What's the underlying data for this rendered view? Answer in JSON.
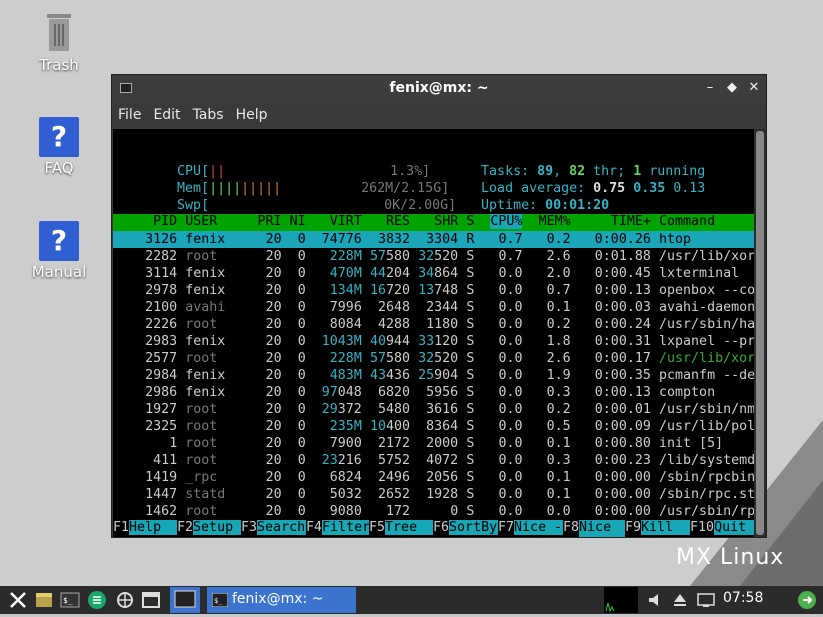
{
  "desktop": {
    "icons": [
      {
        "label": "Trash",
        "icon": "trash-icon"
      },
      {
        "label": "FAQ",
        "icon": "question-icon"
      },
      {
        "label": "Manual",
        "icon": "question-icon"
      }
    ],
    "logo": "MX Linux",
    "colors": {
      "accent": "#3b73cf",
      "background": "#cfcfcf"
    }
  },
  "window": {
    "title": "fenix@mx: ~",
    "menu": [
      "File",
      "Edit",
      "Tabs",
      "Help"
    ]
  },
  "htop": {
    "meters": {
      "cpu_label": "CPU[",
      "cpu_value": "1.3%]",
      "mem_label": "Mem[",
      "mem_value": "262M/2.15G]",
      "swp_label": "Swp[",
      "swp_value": "0K/2.00G]"
    },
    "tasks": {
      "label": "Tasks:",
      "count": "89",
      "thr": "82",
      "thr_label": "thr;",
      "running": "1",
      "running_label": "running"
    },
    "load": {
      "label": "Load average:",
      "v1": "0.75",
      "v2": "0.35",
      "v3": "0.13"
    },
    "uptime": {
      "label": "Uptime:",
      "value": "00:01:20"
    },
    "columns": [
      "PID",
      "USER",
      "PRI",
      "NI",
      "VIRT",
      "RES",
      "SHR",
      "S",
      "CPU%",
      "MEM%",
      "TIME+",
      "Command"
    ],
    "processes": [
      {
        "pid": "3126",
        "user": "fenix",
        "pri": "20",
        "ni": "0",
        "virt": "74776",
        "res": "3832",
        "shr": "3304",
        "s": "R",
        "cpu": "0.7",
        "mem": "0.2",
        "time": "0:00.26",
        "cmd": "htop"
      },
      {
        "pid": "2282",
        "user": "root",
        "pri": "20",
        "ni": "0",
        "virt": "228M",
        "res": "57580",
        "shr": "32520",
        "s": "S",
        "cpu": "0.7",
        "mem": "2.6",
        "time": "0:01.88",
        "cmd": "/usr/lib/xorg/Xor"
      },
      {
        "pid": "3114",
        "user": "fenix",
        "pri": "20",
        "ni": "0",
        "virt": "470M",
        "res": "44204",
        "shr": "34864",
        "s": "S",
        "cpu": "0.0",
        "mem": "2.0",
        "time": "0:00.45",
        "cmd": "lxterminal"
      },
      {
        "pid": "2978",
        "user": "fenix",
        "pri": "20",
        "ni": "0",
        "virt": "134M",
        "res": "16720",
        "shr": "13748",
        "s": "S",
        "cpu": "0.0",
        "mem": "0.7",
        "time": "0:00.13",
        "cmd": "openbox --config-"
      },
      {
        "pid": "2100",
        "user": "avahi",
        "pri": "20",
        "ni": "0",
        "virt": "7996",
        "res": "2648",
        "shr": "2344",
        "s": "S",
        "cpu": "0.0",
        "mem": "0.1",
        "time": "0:00.03",
        "cmd": "avahi-daemon: run"
      },
      {
        "pid": "2226",
        "user": "root",
        "pri": "20",
        "ni": "0",
        "virt": "8084",
        "res": "4288",
        "shr": "1180",
        "s": "S",
        "cpu": "0.0",
        "mem": "0.2",
        "time": "0:00.24",
        "cmd": "/usr/sbin/haveged"
      },
      {
        "pid": "2983",
        "user": "fenix",
        "pri": "20",
        "ni": "0",
        "virt": "1043M",
        "res": "40944",
        "shr": "33120",
        "s": "S",
        "cpu": "0.0",
        "mem": "1.8",
        "time": "0:00.31",
        "cmd": "lxpanel --profile"
      },
      {
        "pid": "2577",
        "user": "root",
        "pri": "20",
        "ni": "0",
        "virt": "228M",
        "res": "57580",
        "shr": "32520",
        "s": "S",
        "cpu": "0.0",
        "mem": "2.6",
        "time": "0:00.17",
        "cmd": "/usr/lib/xorg/Xor"
      },
      {
        "pid": "2984",
        "user": "fenix",
        "pri": "20",
        "ni": "0",
        "virt": "483M",
        "res": "43436",
        "shr": "25904",
        "s": "S",
        "cpu": "0.0",
        "mem": "1.9",
        "time": "0:00.35",
        "cmd": "pcmanfm --desktop"
      },
      {
        "pid": "2986",
        "user": "fenix",
        "pri": "20",
        "ni": "0",
        "virt": "97048",
        "res": "6820",
        "shr": "5956",
        "s": "S",
        "cpu": "0.0",
        "mem": "0.3",
        "time": "0:00.13",
        "cmd": "compton"
      },
      {
        "pid": "1927",
        "user": "root",
        "pri": "20",
        "ni": "0",
        "virt": "29372",
        "res": "5480",
        "shr": "3616",
        "s": "S",
        "cpu": "0.0",
        "mem": "0.2",
        "time": "0:00.01",
        "cmd": "/usr/sbin/nmbd -D"
      },
      {
        "pid": "2325",
        "user": "root",
        "pri": "20",
        "ni": "0",
        "virt": "235M",
        "res": "10400",
        "shr": "8364",
        "s": "S",
        "cpu": "0.0",
        "mem": "0.5",
        "time": "0:00.09",
        "cmd": "/usr/lib/policyki"
      },
      {
        "pid": "1",
        "user": "root",
        "pri": "20",
        "ni": "0",
        "virt": "7900",
        "res": "2172",
        "shr": "2000",
        "s": "S",
        "cpu": "0.0",
        "mem": "0.1",
        "time": "0:00.80",
        "cmd": "init [5]"
      },
      {
        "pid": "411",
        "user": "root",
        "pri": "20",
        "ni": "0",
        "virt": "23216",
        "res": "5752",
        "shr": "4072",
        "s": "S",
        "cpu": "0.0",
        "mem": "0.3",
        "time": "0:00.23",
        "cmd": "/lib/systemd/syst"
      },
      {
        "pid": "1419",
        "user": "_rpc",
        "pri": "20",
        "ni": "0",
        "virt": "6824",
        "res": "2496",
        "shr": "2056",
        "s": "S",
        "cpu": "0.0",
        "mem": "0.1",
        "time": "0:00.00",
        "cmd": "/sbin/rpcbind -w"
      },
      {
        "pid": "1447",
        "user": "statd",
        "pri": "20",
        "ni": "0",
        "virt": "5032",
        "res": "2652",
        "shr": "1928",
        "s": "S",
        "cpu": "0.0",
        "mem": "0.1",
        "time": "0:00.00",
        "cmd": "/sbin/rpc.statd"
      },
      {
        "pid": "1462",
        "user": "root",
        "pri": "20",
        "ni": "0",
        "virt": "9080",
        "res": "172",
        "shr": "0",
        "s": "S",
        "cpu": "0.0",
        "mem": "0.0",
        "time": "0:00.00",
        "cmd": "/usr/sbin/rpc.idm"
      }
    ],
    "fkeys": [
      {
        "key": "F1",
        "label": "Help"
      },
      {
        "key": "F2",
        "label": "Setup"
      },
      {
        "key": "F3",
        "label": "Search"
      },
      {
        "key": "F4",
        "label": "Filter"
      },
      {
        "key": "F5",
        "label": "Tree"
      },
      {
        "key": "F6",
        "label": "SortBy"
      },
      {
        "key": "F7",
        "label": "Nice -"
      },
      {
        "key": "F8",
        "label": "Nice +"
      },
      {
        "key": "F9",
        "label": "Kill"
      },
      {
        "key": "F10",
        "label": "Quit"
      }
    ]
  },
  "taskbar": {
    "task_label": "fenix@mx: ~",
    "clock": "07:58",
    "icons": [
      "mx-menu-icon",
      "file-manager-icon",
      "terminal-icon",
      "package-icon",
      "browser-icon",
      "desktop-icon",
      "terminal-window-icon",
      "volume-icon",
      "eject-icon",
      "network-icon",
      "update-icon"
    ]
  }
}
